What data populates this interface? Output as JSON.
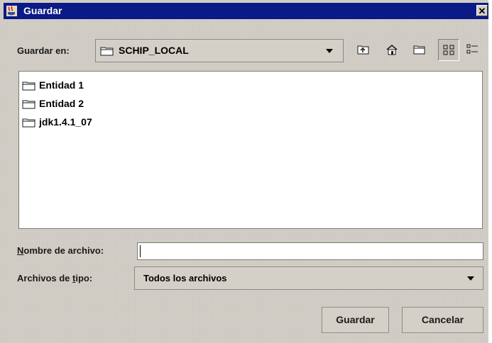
{
  "window": {
    "title": "Guardar",
    "close_glyph": "✕"
  },
  "lookin": {
    "label": "Guardar en:",
    "value": "SCHIP_LOCAL"
  },
  "toolbar": {
    "icons": [
      "up-folder-icon",
      "home-icon",
      "new-folder-icon",
      "list-view-icon",
      "details-view-icon"
    ],
    "pressed": "list-view-icon"
  },
  "files": [
    {
      "name": "Entidad 1",
      "icon": "folder-icon"
    },
    {
      "name": "Entidad 2",
      "icon": "folder-icon"
    },
    {
      "name": "jdk1.4.1_07",
      "icon": "folder-icon"
    }
  ],
  "filename": {
    "label_first": "N",
    "label_rest": "ombre de archivo:",
    "value": ""
  },
  "filetype": {
    "label_before": "Archivos de ",
    "label_mnemonic": "t",
    "label_after": "ipo:",
    "value": "Todos los archivos"
  },
  "buttons": {
    "save": "Guardar",
    "cancel": "Cancelar"
  },
  "colors": {
    "titlebar": "#0a1a86",
    "background": "#d4d0c8",
    "list_bg": "#ffffff"
  }
}
